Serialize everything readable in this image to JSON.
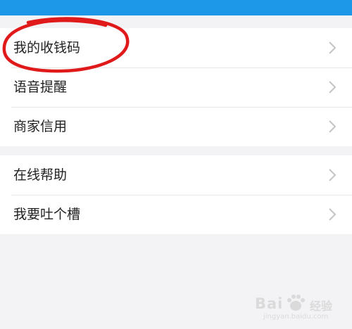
{
  "group_1": [
    {
      "label": "我的收钱码"
    },
    {
      "label": "语音提醒"
    },
    {
      "label": "商家信用"
    }
  ],
  "group_2": [
    {
      "label": "在线帮助"
    },
    {
      "label": "我要吐个槽"
    }
  ],
  "icons": {
    "chevron": "chevron-right-icon",
    "annotation": "red-circle-annotation"
  },
  "colors": {
    "topbar": "#1d97e8",
    "background": "#f3f3f5",
    "annotation": "#e0191a"
  },
  "watermark": {
    "brand": "Bai",
    "suffix": "经验",
    "url": "jingyan.baidu.com"
  }
}
